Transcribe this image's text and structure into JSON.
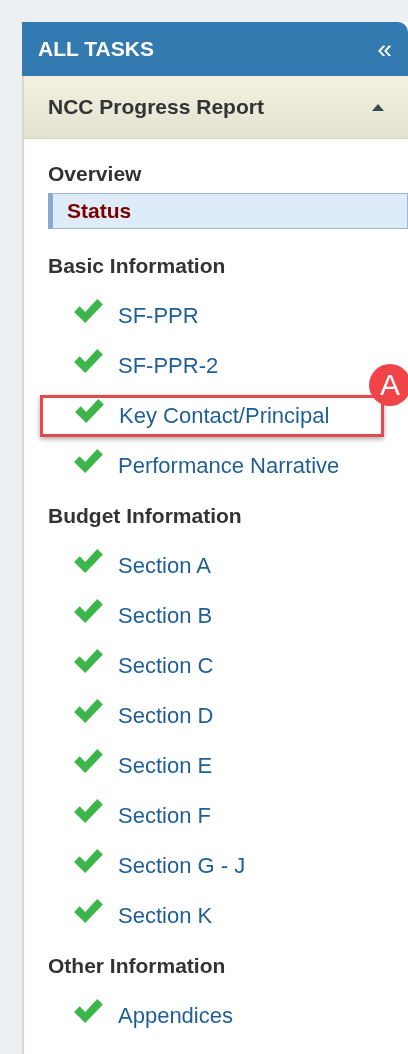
{
  "panel": {
    "title": "ALL TASKS",
    "collapse_icon": "«"
  },
  "section": {
    "title": "NCC Progress Report",
    "expanded": true
  },
  "groups": [
    {
      "title": "Overview",
      "items": [
        {
          "label": "Status",
          "checked": false,
          "selected": true,
          "highlighted": false
        }
      ]
    },
    {
      "title": "Basic Information",
      "items": [
        {
          "label": "SF-PPR",
          "checked": true,
          "selected": false,
          "highlighted": false
        },
        {
          "label": "SF-PPR-2",
          "checked": true,
          "selected": false,
          "highlighted": false
        },
        {
          "label": "Key Contact/Principal",
          "checked": true,
          "selected": false,
          "highlighted": true,
          "callout": "A"
        },
        {
          "label": "Performance Narrative",
          "checked": true,
          "selected": false,
          "highlighted": false
        }
      ]
    },
    {
      "title": "Budget Information",
      "items": [
        {
          "label": "Section A",
          "checked": true,
          "selected": false,
          "highlighted": false
        },
        {
          "label": "Section B",
          "checked": true,
          "selected": false,
          "highlighted": false
        },
        {
          "label": "Section C",
          "checked": true,
          "selected": false,
          "highlighted": false
        },
        {
          "label": "Section D",
          "checked": true,
          "selected": false,
          "highlighted": false
        },
        {
          "label": "Section E",
          "checked": true,
          "selected": false,
          "highlighted": false
        },
        {
          "label": "Section F",
          "checked": true,
          "selected": false,
          "highlighted": false
        },
        {
          "label": "Section G - J",
          "checked": true,
          "selected": false,
          "highlighted": false
        },
        {
          "label": "Section K",
          "checked": true,
          "selected": false,
          "highlighted": false
        }
      ]
    },
    {
      "title": "Other Information",
      "items": [
        {
          "label": "Appendices",
          "checked": true,
          "selected": false,
          "highlighted": false
        }
      ]
    }
  ]
}
